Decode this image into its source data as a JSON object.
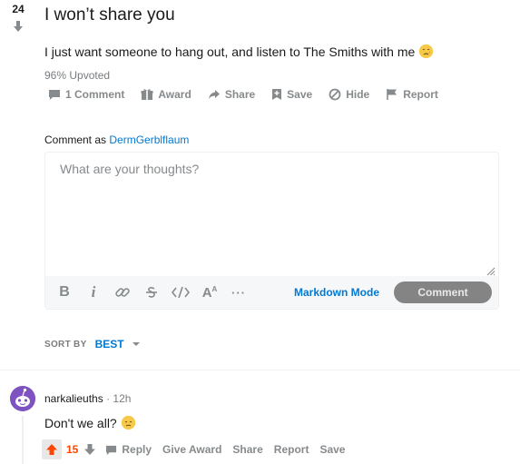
{
  "post": {
    "score": "24",
    "title": "I won’t share you",
    "body": "I just want someone to hang out, and listen to The Smiths with me",
    "upvoted": "96% Upvoted"
  },
  "actions": {
    "comment": "1 Comment",
    "award": "Award",
    "share": "Share",
    "save": "Save",
    "hide": "Hide",
    "report": "Report"
  },
  "composer": {
    "comment_as_label": "Comment as",
    "username": "DermGerblflaum",
    "placeholder": "What are your thoughts?",
    "markdown_mode": "Markdown Mode",
    "submit": "Comment"
  },
  "sort": {
    "label": "SORT BY",
    "value": "BEST"
  },
  "comment": {
    "author": "narkalieuths",
    "time": "· 12h",
    "body": "Don't we all?",
    "score": "15",
    "reply": "Reply",
    "give_award": "Give Award",
    "share": "Share",
    "report": "Report",
    "save": "Save"
  },
  "colors": {
    "accent_blue": "#0079d3",
    "upvote_orange": "#ff4500",
    "muted_gray": "#878a8c",
    "avatar_purple": "#7e53c1"
  },
  "icons": [
    "down-arrow-icon",
    "comment-icon",
    "award-icon",
    "share-icon",
    "save-icon",
    "hide-icon",
    "report-icon",
    "bold-icon",
    "italic-icon",
    "link-icon",
    "strikethrough-icon",
    "code-icon",
    "superscript-icon",
    "more-icon",
    "resize-grip-icon",
    "sort-caret-icon",
    "upvote-icon",
    "downvote-icon",
    "reply-icon",
    "emoji-sad-icon"
  ]
}
